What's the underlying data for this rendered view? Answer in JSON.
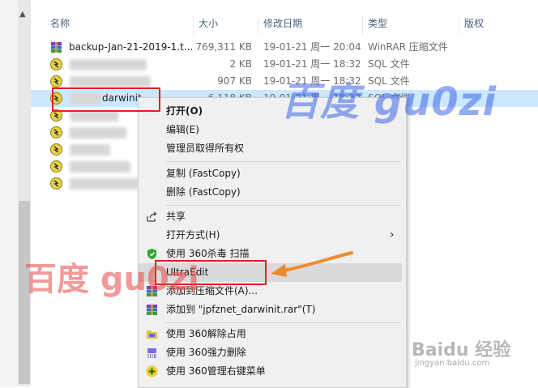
{
  "columns": {
    "name": "名称",
    "size": "大小",
    "modified": "修改日期",
    "type": "类型",
    "permission": "版权"
  },
  "files": [
    {
      "name": "backup-Jan-21-2019-1.t...",
      "size": "769,311 KB",
      "date": "19-01-21 周一 20:04",
      "type": "WinRAR 压缩文件",
      "icon": "winrar-archive-icon"
    },
    {
      "name": "",
      "size": "2 KB",
      "date": "19-01-21 周一 18:32",
      "type": "SQL 文件",
      "icon": "sql-file-icon"
    },
    {
      "name": "",
      "size": "907 KB",
      "date": "19-01-21 周一 18:32",
      "type": "SQL 文件",
      "icon": "sql-file-icon"
    },
    {
      "name": "darwinit",
      "size": "6,118 KB",
      "date": "19-01-21 周一 18:32",
      "type": "SQL 文件",
      "icon": "sql-file-icon"
    },
    {
      "name": "",
      "size": "",
      "date": "",
      "type": "件",
      "icon": "sql-file-icon"
    },
    {
      "name": "",
      "size": "",
      "date": "",
      "type": "件",
      "icon": "sql-file-icon"
    },
    {
      "name": "",
      "size": "",
      "date": "",
      "type": "件",
      "icon": "sql-file-icon"
    },
    {
      "name": "",
      "size": "",
      "date": "",
      "type": "件",
      "icon": "sql-file-icon"
    },
    {
      "name": "",
      "size": "",
      "date": "",
      "type": "件",
      "icon": "sql-file-icon"
    }
  ],
  "menu": {
    "open": "打开(O)",
    "edit": "编辑(E)",
    "admin_owner": "管理员取得所有权",
    "copy_fastcopy": "复制 (FastCopy)",
    "delete_fastcopy": "删除 (FastCopy)",
    "share": "共享",
    "open_with": "打开方式(H)",
    "scan_360": "使用 360杀毒 扫描",
    "ultraedit": "UltraEdit",
    "add_to_archive": "添加到压缩文件(A)...",
    "add_to_rar": "添加到 \"jpfznet_darwinit.rar\"(T)",
    "unlock_360": "使用 360解除占用",
    "force_delete_360": "使用 360强力删除",
    "manage_menu_360": "使用 360管理右键菜单"
  },
  "watermarks": {
    "top": "百度 gu0zi",
    "left": "百度 gu0zi",
    "baidu": "Baidu 经验",
    "url": "jingyan.baidu.com"
  },
  "colors": {
    "selection": "#cce8ff",
    "annotation": "#e02020",
    "arrow": "#f08a30",
    "menu_bg": "#f0f0f0"
  }
}
